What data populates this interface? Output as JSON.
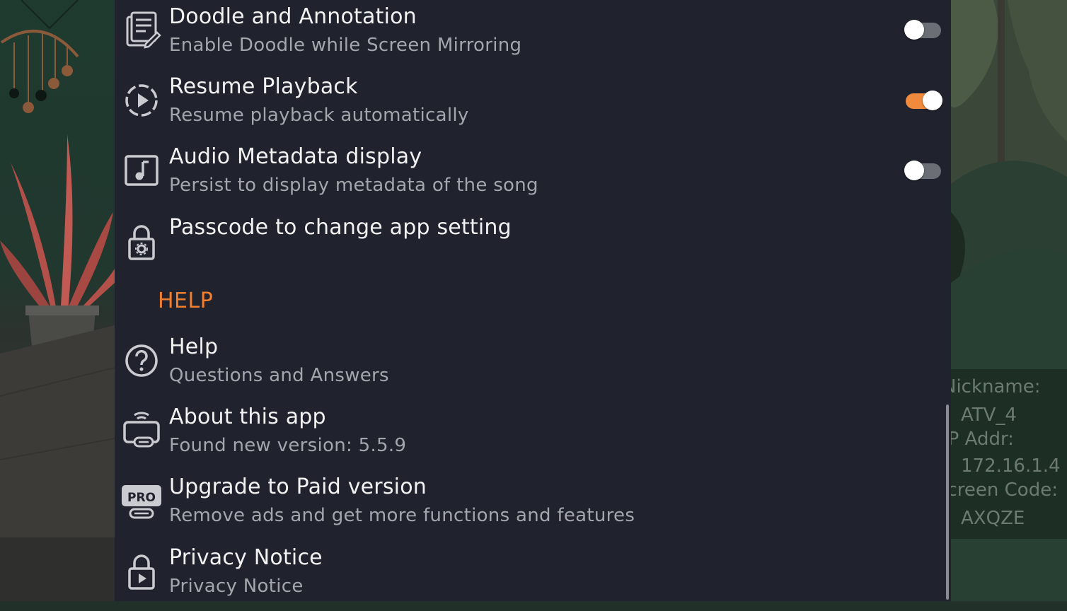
{
  "settings": {
    "rows": [
      {
        "title": "Doodle and Annotation",
        "subtitle": "Enable Doodle while Screen Mirroring",
        "toggle": "off"
      },
      {
        "title": "Resume Playback",
        "subtitle": "Resume playback automatically",
        "toggle": "on"
      },
      {
        "title": "Audio Metadata display",
        "subtitle": "Persist to display metadata of the song",
        "toggle": "off"
      },
      {
        "title": "Passcode to change app setting",
        "subtitle": ""
      }
    ],
    "help_header": "HELP",
    "help_rows": [
      {
        "title": "Help",
        "subtitle": "Questions and Answers"
      },
      {
        "title": "About this app",
        "subtitle": "Found new version: 5.5.9"
      },
      {
        "title": "Upgrade to Paid version",
        "subtitle": "Remove ads and get more functions and features"
      },
      {
        "title": "Privacy Notice",
        "subtitle": "Privacy Notice"
      }
    ],
    "pro_badge": "PRO"
  },
  "device_info": {
    "nickname_label": "Nickname:",
    "nickname_value": "ATV_4",
    "ip_label": "IP Addr:",
    "ip_value": "172.16.1.4",
    "screen_code_label": "Screen Code:",
    "screen_code_value": "AXQZE"
  },
  "colors": {
    "accent": "#f07f2f",
    "panel_bg": "#20222d",
    "toggle_on": "#f08a3c",
    "toggle_off": "#6b6e75"
  }
}
